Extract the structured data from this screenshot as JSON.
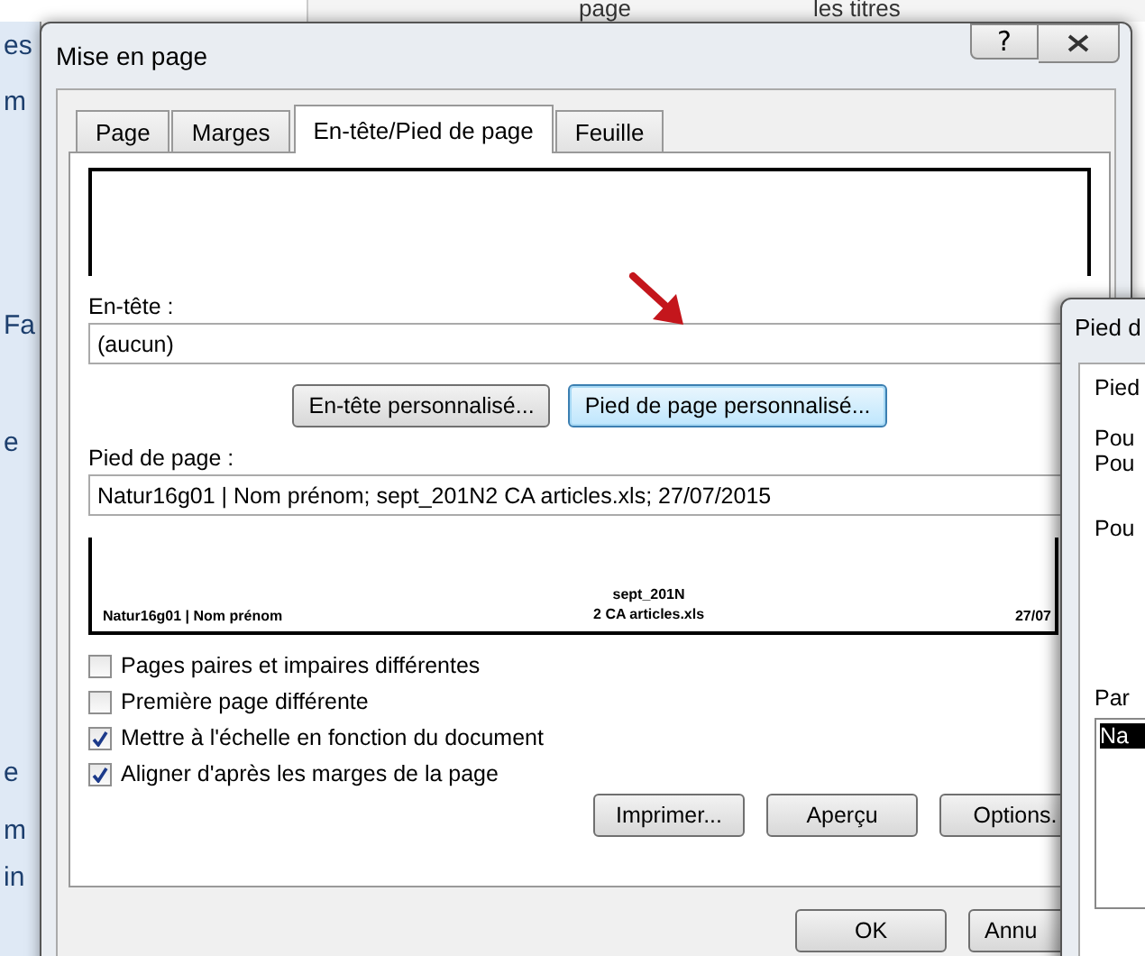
{
  "background_app": {
    "top_texts": [
      "page",
      "les titres"
    ],
    "side_texts": [
      "es",
      "m",
      "Fa",
      "e",
      "e",
      "m",
      "in"
    ]
  },
  "dialog": {
    "title": "Mise en page",
    "help_button": "?",
    "tabs": [
      {
        "label": "Page",
        "selected": false
      },
      {
        "label": "Marges",
        "selected": false
      },
      {
        "label": "En-tête/Pied de page",
        "selected": true
      },
      {
        "label": "Feuille",
        "selected": false
      }
    ],
    "header_label": "En-tête :",
    "header_value": "(aucun)",
    "custom_buttons": [
      {
        "label": "En-tête personnalisé...",
        "focused": false
      },
      {
        "label": "Pied de page personnalisé...",
        "focused": true
      }
    ],
    "footer_label": "Pied de page :",
    "footer_value": "Natur16g01 | Nom prénom; sept_201N2 CA articles.xls; 27/07/2015",
    "footer_preview": {
      "left": "Natur16g01 | Nom prénom",
      "center": [
        "sept_201N",
        "2 CA articles.xls"
      ],
      "right": "27/07"
    },
    "options": [
      {
        "label": "Pages paires et impaires différentes",
        "checked": false
      },
      {
        "label": "Première page différente",
        "checked": false
      },
      {
        "label": "Mettre à l'échelle en fonction du document",
        "checked": true
      },
      {
        "label": "Aligner d'après les marges de la page",
        "checked": true
      }
    ],
    "action_buttons": [
      "Imprimer...",
      "Aperçu",
      "Options."
    ],
    "dialog_buttons": [
      "OK",
      "Annu"
    ]
  },
  "second_dialog": {
    "title": "Pied d",
    "texts": [
      "Pied",
      "Pou",
      "Pou",
      "Pou"
    ],
    "list_label": "Par",
    "selected_text": "Na"
  }
}
